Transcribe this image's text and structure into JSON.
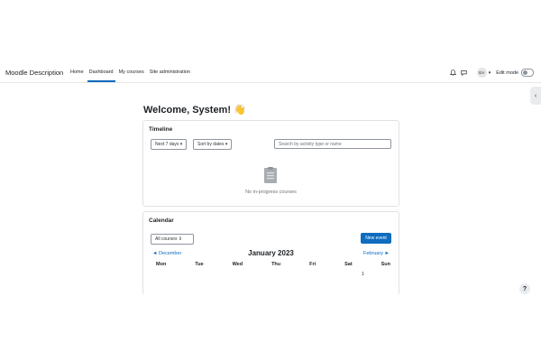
{
  "brand": {
    "title": "Moodle Description"
  },
  "nav": {
    "items": [
      {
        "label": "Home",
        "active": false
      },
      {
        "label": "Dashboard",
        "active": true
      },
      {
        "label": "My courses",
        "active": false
      },
      {
        "label": "Site administration",
        "active": false
      }
    ]
  },
  "user": {
    "initials": "EA",
    "edit_mode_label": "Edit mode",
    "edit_mode_on": false
  },
  "page": {
    "welcome": "Welcome, System! 👋"
  },
  "timeline": {
    "title": "Timeline",
    "filter_label": "Next 7 days",
    "sort_label": "Sort by dates",
    "search_placeholder": "Search by activity type or name",
    "empty_text": "No in-progress courses"
  },
  "calendar": {
    "title": "Calendar",
    "course_filter": "All courses",
    "new_event_label": "New event",
    "prev_month": "◄ December",
    "next_month": "February ►",
    "month_title": "January 2023",
    "weekdays": [
      "Mon",
      "Tue",
      "Wed",
      "Thu",
      "Fri",
      "Sat",
      "Sun"
    ],
    "first_day": "1"
  },
  "colors": {
    "primary": "#0f6cbf"
  }
}
